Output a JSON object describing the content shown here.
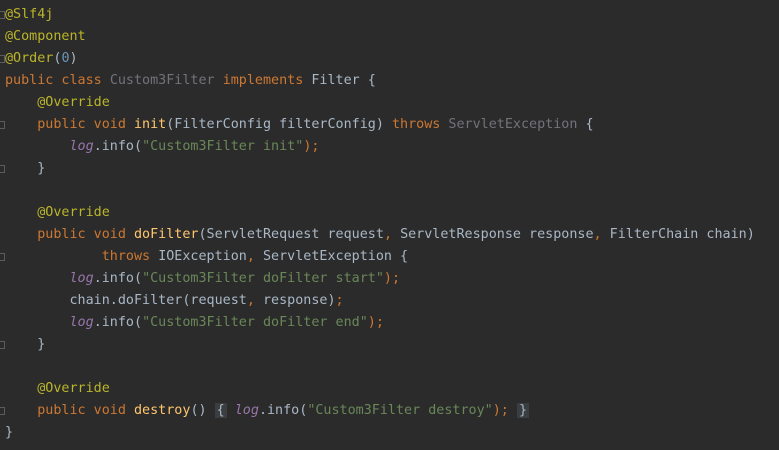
{
  "editor": {
    "lines": [
      {
        "fold": true,
        "tokens": [
          {
            "t": "@Slf4j",
            "k": "annotation"
          }
        ]
      },
      {
        "fold": false,
        "tokens": [
          {
            "t": "@Component",
            "k": "annotation"
          }
        ]
      },
      {
        "fold": true,
        "tokens": [
          {
            "t": "@Order",
            "k": "annotation"
          },
          {
            "t": "(",
            "k": "plain"
          },
          {
            "t": "0",
            "k": "number"
          },
          {
            "t": ")",
            "k": "plain"
          }
        ]
      },
      {
        "fold": false,
        "tokens": [
          {
            "t": "public class ",
            "k": "keyword"
          },
          {
            "t": "Custom3Filter ",
            "k": "unused"
          },
          {
            "t": "implements ",
            "k": "keyword"
          },
          {
            "t": "Filter {",
            "k": "plain"
          }
        ]
      },
      {
        "fold": false,
        "tokens": [
          {
            "t": "    ",
            "k": "plain"
          },
          {
            "t": "@Override",
            "k": "annotation"
          }
        ]
      },
      {
        "fold": true,
        "tokens": [
          {
            "t": "    ",
            "k": "plain"
          },
          {
            "t": "public void ",
            "k": "keyword"
          },
          {
            "t": "init",
            "k": "method-def"
          },
          {
            "t": "(FilterConfig filterConfig) ",
            "k": "plain"
          },
          {
            "t": "throws ",
            "k": "keyword"
          },
          {
            "t": "ServletException ",
            "k": "unused"
          },
          {
            "t": "{",
            "k": "plain"
          }
        ]
      },
      {
        "fold": false,
        "tokens": [
          {
            "t": "        ",
            "k": "plain"
          },
          {
            "t": "log",
            "k": "field"
          },
          {
            "t": ".info(",
            "k": "plain"
          },
          {
            "t": "\"Custom3Filter init\"",
            "k": "string"
          },
          {
            "t": ");",
            "k": "keyword"
          }
        ]
      },
      {
        "fold": true,
        "tokens": [
          {
            "t": "    }",
            "k": "plain"
          }
        ]
      },
      {
        "fold": false,
        "tokens": []
      },
      {
        "fold": false,
        "tokens": [
          {
            "t": "    ",
            "k": "plain"
          },
          {
            "t": "@Override",
            "k": "annotation"
          }
        ]
      },
      {
        "fold": false,
        "tokens": [
          {
            "t": "    ",
            "k": "plain"
          },
          {
            "t": "public void ",
            "k": "keyword"
          },
          {
            "t": "doFilter",
            "k": "method-def"
          },
          {
            "t": "(ServletRequest request",
            "k": "plain"
          },
          {
            "t": ", ",
            "k": "keyword"
          },
          {
            "t": "ServletResponse response",
            "k": "plain"
          },
          {
            "t": ", ",
            "k": "keyword"
          },
          {
            "t": "FilterChain chain)",
            "k": "plain"
          }
        ]
      },
      {
        "fold": true,
        "tokens": [
          {
            "t": "            ",
            "k": "plain"
          },
          {
            "t": "throws ",
            "k": "keyword"
          },
          {
            "t": "IOException",
            "k": "plain"
          },
          {
            "t": ", ",
            "k": "keyword"
          },
          {
            "t": "ServletException {",
            "k": "plain"
          }
        ]
      },
      {
        "fold": false,
        "tokens": [
          {
            "t": "        ",
            "k": "plain"
          },
          {
            "t": "log",
            "k": "field"
          },
          {
            "t": ".info(",
            "k": "plain"
          },
          {
            "t": "\"Custom3Filter doFilter start\"",
            "k": "string"
          },
          {
            "t": ");",
            "k": "keyword"
          }
        ]
      },
      {
        "fold": false,
        "tokens": [
          {
            "t": "        chain.doFilter(request",
            "k": "plain"
          },
          {
            "t": ", ",
            "k": "keyword"
          },
          {
            "t": "response)",
            "k": "plain"
          },
          {
            "t": ";",
            "k": "keyword"
          }
        ]
      },
      {
        "fold": false,
        "tokens": [
          {
            "t": "        ",
            "k": "plain"
          },
          {
            "t": "log",
            "k": "field"
          },
          {
            "t": ".info(",
            "k": "plain"
          },
          {
            "t": "\"Custom3Filter doFilter end\"",
            "k": "string"
          },
          {
            "t": ");",
            "k": "keyword"
          }
        ]
      },
      {
        "fold": true,
        "tokens": [
          {
            "t": "    }",
            "k": "plain"
          }
        ]
      },
      {
        "fold": false,
        "tokens": []
      },
      {
        "fold": false,
        "tokens": [
          {
            "t": "    ",
            "k": "plain"
          },
          {
            "t": "@Override",
            "k": "annotation"
          }
        ]
      },
      {
        "fold": true,
        "tokens": [
          {
            "t": "    ",
            "k": "plain"
          },
          {
            "t": "public void ",
            "k": "keyword"
          },
          {
            "t": "destroy",
            "k": "method-def"
          },
          {
            "t": "() ",
            "k": "plain"
          },
          {
            "t": "{",
            "k": "fold"
          },
          {
            "t": " ",
            "k": "plain"
          },
          {
            "t": "log",
            "k": "field"
          },
          {
            "t": ".info(",
            "k": "plain"
          },
          {
            "t": "\"Custom3Filter destroy\"",
            "k": "string"
          },
          {
            "t": ");",
            "k": "keyword"
          },
          {
            "t": " ",
            "k": "plain"
          },
          {
            "t": "}",
            "k": "fold"
          }
        ]
      },
      {
        "fold": false,
        "tokens": [
          {
            "t": "}",
            "k": "plain"
          }
        ]
      }
    ]
  },
  "colors": {
    "background": "#2b2b2b",
    "annotation": "#bbb529",
    "keyword": "#cc7832",
    "plain": "#a9b7c6",
    "number": "#6897bb",
    "string": "#6a8759",
    "unused": "#72737a",
    "method_def": "#ffc66d",
    "field": "#9876aa"
  }
}
